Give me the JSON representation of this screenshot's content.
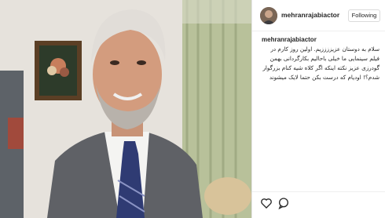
{
  "post": {
    "username": "mehranrajabiactor",
    "follow_label": "Following",
    "caption_user": "mehranrajabiactor",
    "caption_text": "سلام به دوستان عزیززززیم. اولین روز کارم در فیلم سینمایی ما خیلی باحالیم بکارگردانی بهمن گودرزی عزیز نکته اینکه اگر کلاه شیه کنام بزرگوار شدم؟! اودیام که درست بکن حتما لایک میشوند"
  },
  "icons": {
    "like": "heart-outline-icon",
    "comment": "comment-bubble-icon"
  }
}
